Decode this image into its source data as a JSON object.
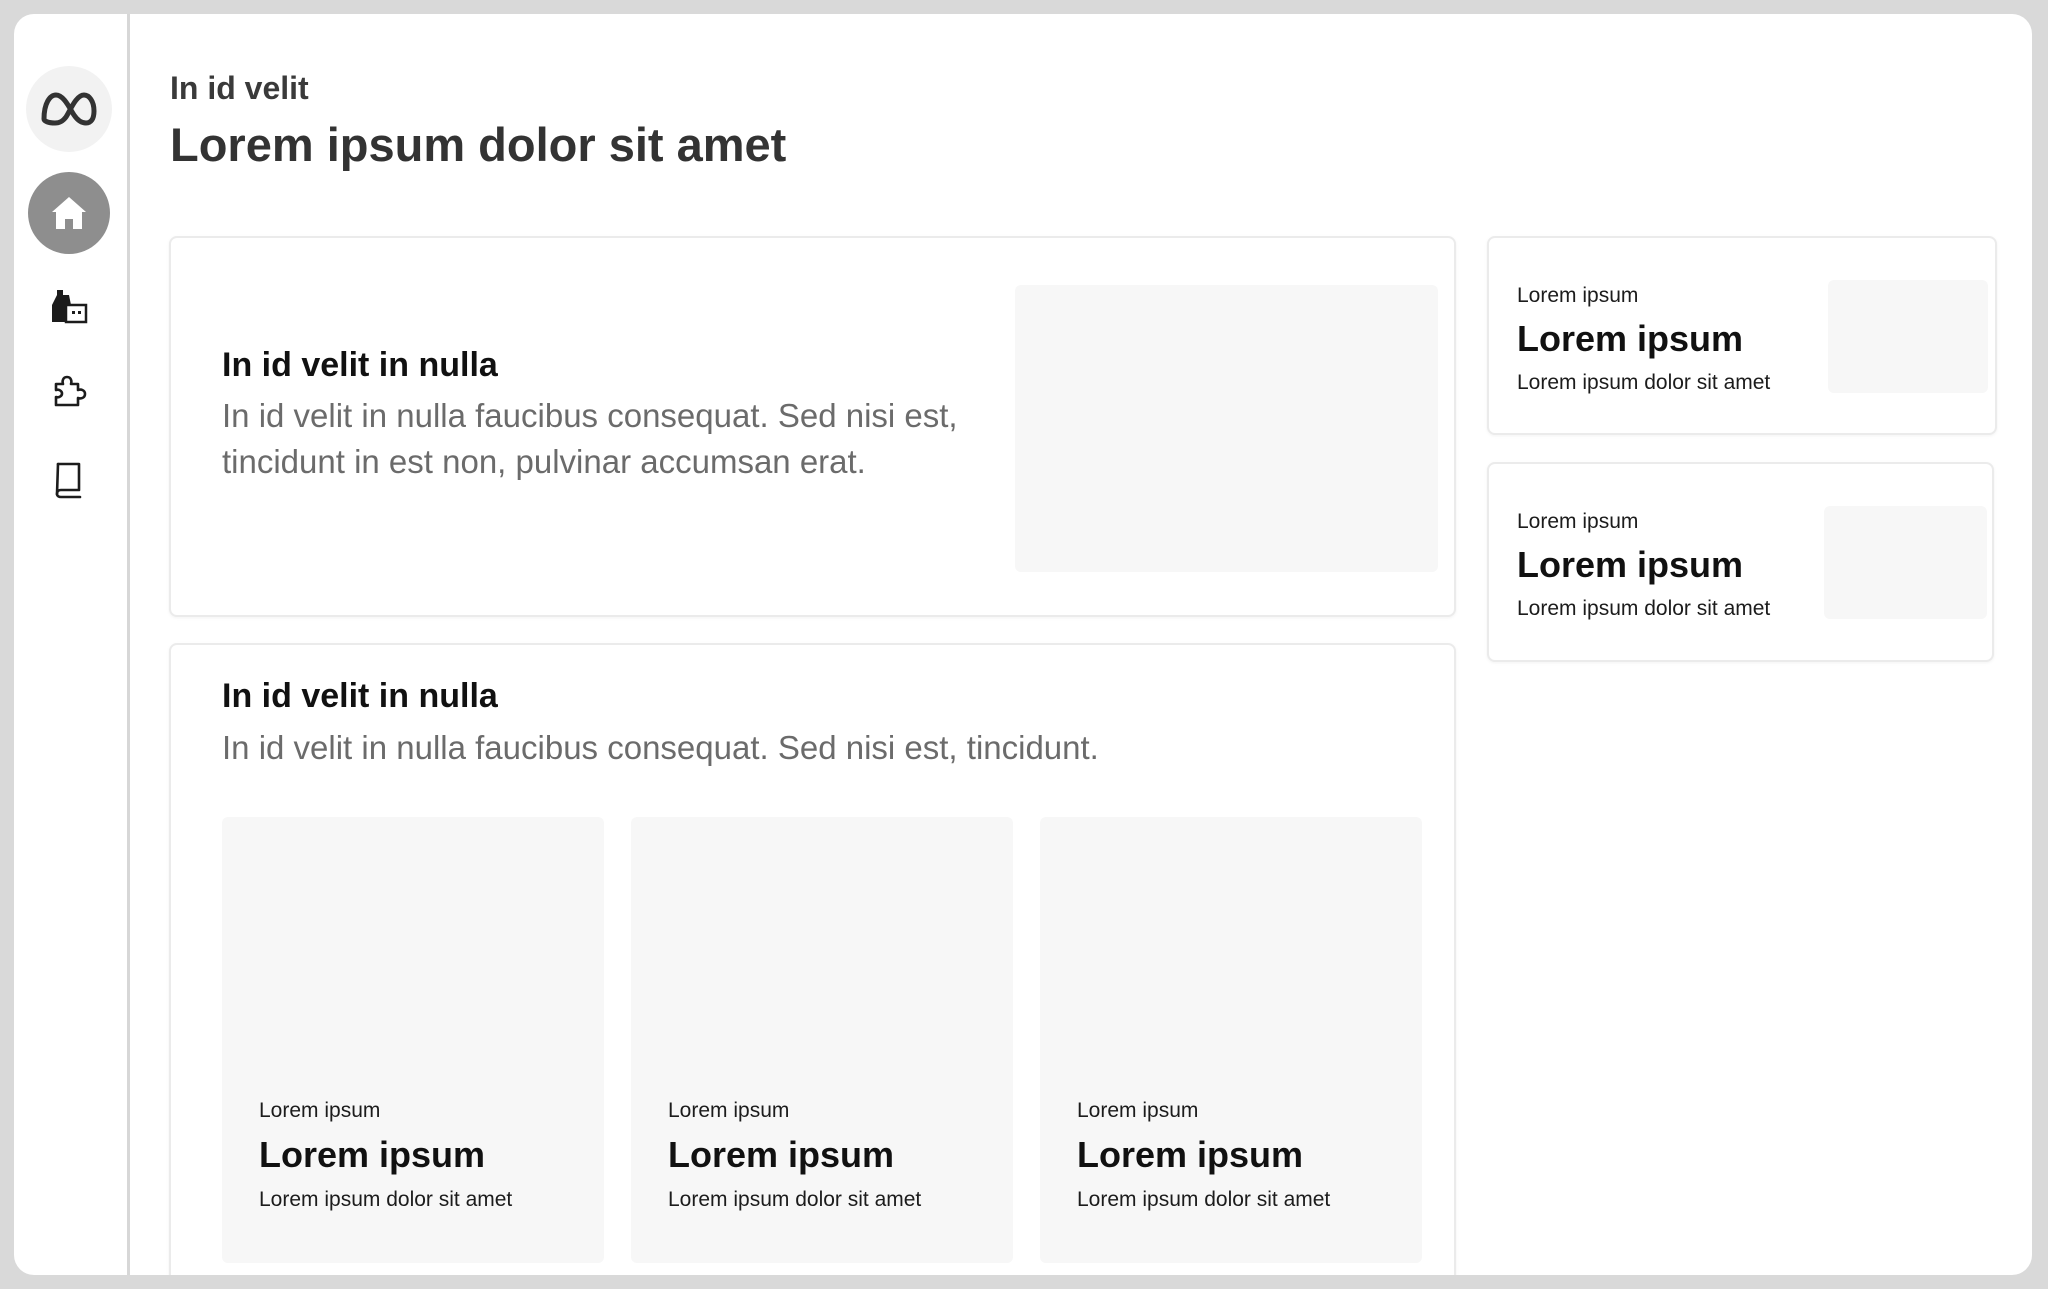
{
  "sidebar": {
    "items": [
      {
        "icon": "meta-logo-icon"
      },
      {
        "icon": "home-icon",
        "active": true
      },
      {
        "icon": "store-icon"
      },
      {
        "icon": "puzzle-icon"
      },
      {
        "icon": "book-icon"
      }
    ]
  },
  "header": {
    "eyebrow": "In id velit",
    "title": "Lorem ipsum dolor sit amet"
  },
  "feature_card": {
    "title": "In id velit in nulla",
    "description": "In id velit in nulla faucibus consequat. Sed nisi est, tincidunt in est non, pulvinar accumsan erat."
  },
  "collection_card": {
    "title": "In id velit in nulla",
    "description": "In id velit in nulla faucibus consequat. Sed nisi est, tincidunt.",
    "tiles": [
      {
        "eyebrow": "Lorem ipsum",
        "title": "Lorem ipsum",
        "subtitle": "Lorem ipsum dolor sit amet"
      },
      {
        "eyebrow": "Lorem ipsum",
        "title": "Lorem ipsum",
        "subtitle": "Lorem ipsum dolor sit amet"
      },
      {
        "eyebrow": "Lorem ipsum",
        "title": "Lorem ipsum",
        "subtitle": "Lorem ipsum dolor sit amet"
      }
    ]
  },
  "side_cards": [
    {
      "eyebrow": "Lorem ipsum",
      "title": "Lorem ipsum",
      "subtitle": "Lorem ipsum dolor sit amet"
    },
    {
      "eyebrow": "Lorem ipsum",
      "title": "Lorem ipsum",
      "subtitle": "Lorem ipsum dolor sit amet"
    }
  ],
  "colors": {
    "active_nav_bg": "#8e8e8e",
    "placeholder_bg": "#f7f7f7",
    "text_muted": "#6b6b6b"
  }
}
